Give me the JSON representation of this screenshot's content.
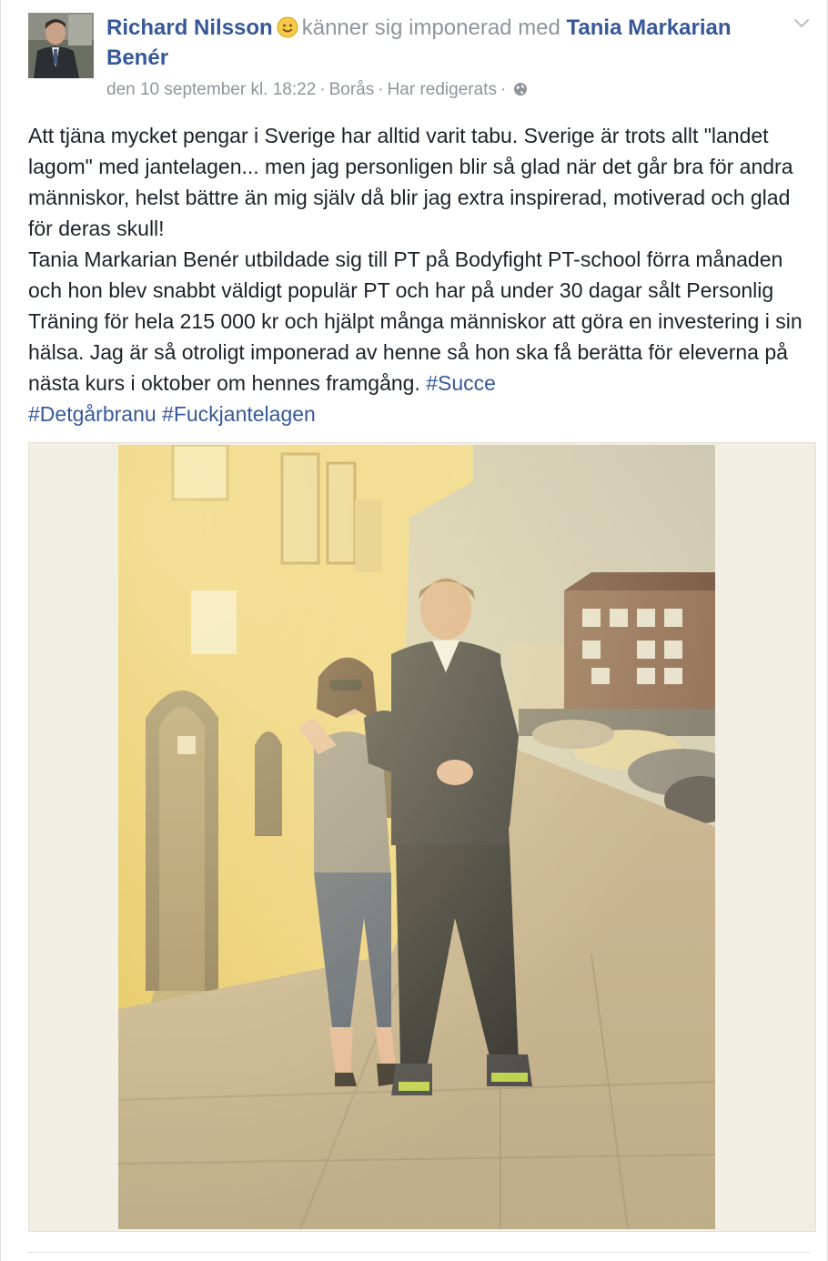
{
  "post": {
    "author": "Richard Nilsson",
    "feeling": "känner sig imponerad med",
    "tagged": "Tania Markarian Benér",
    "meta": {
      "date": "den 10 september kl. 18:22",
      "location": "Borås",
      "edited": "Har redigerats",
      "separator": "·"
    },
    "paragraph1": "Att tjäna mycket pengar i Sverige har alltid varit tabu. Sverige är trots allt \"landet lagom\" med jantelagen... men jag personligen blir så glad när det går bra för andra människor, helst bättre än mig själv då blir jag extra inspirerad, motiverad och glad för deras skull!",
    "paragraph2": "Tania Markarian Benér utbildade sig till PT på Bodyfight PT-school förra månaden och hon blev snabbt väldigt populär PT och har på under 30 dagar sålt Personlig Träning för hela 215 000 kr och hjälpt många människor att göra en investering i sin hälsa. Jag är så otroligt imponerad av henne så hon ska få berätta för eleverna på nästa kurs i oktober om hennes framgång.",
    "hashtags": [
      "#Succe",
      "#Detgårbranu",
      "#Fuckjantelagen"
    ]
  },
  "icons": {
    "feeling": "smiley-emoji-icon",
    "audience": "globe-icon",
    "menu": "chevron-down-icon"
  },
  "colors": {
    "link": "#365899",
    "meta": "#90949c",
    "text": "#1d2129"
  }
}
